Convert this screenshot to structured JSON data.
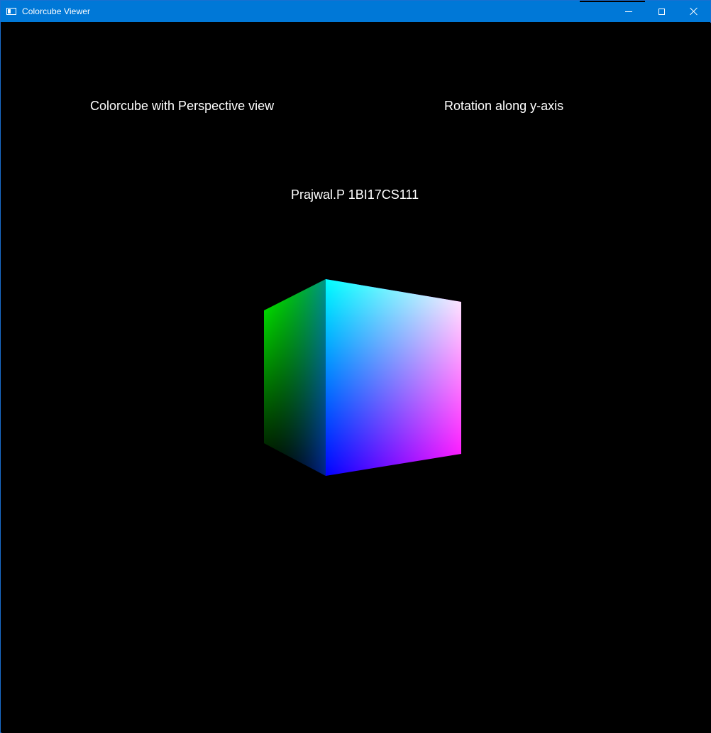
{
  "window": {
    "title": "Colorcube Viewer",
    "icon": "app-window-icon"
  },
  "controls": {
    "minimize_icon": "minimize-icon",
    "maximize_icon": "maximize-icon",
    "close_icon": "close-icon"
  },
  "scene": {
    "label_left": "Colorcube with Perspective view",
    "label_right": "Rotation along y-axis",
    "label_center": "Prajwal.P 1BI17CS111",
    "background": "#000000"
  },
  "colors": {
    "titlebar": "#0078d7",
    "text": "#ffffff",
    "cube_top_left": "#00ff00",
    "cube_top_mid": "#00ffff",
    "cube_top_right": "#ffffff",
    "cube_bottom_left": "#000000",
    "cube_bottom_mid": "#0000ff",
    "cube_bottom_right": "#ff00ff"
  }
}
